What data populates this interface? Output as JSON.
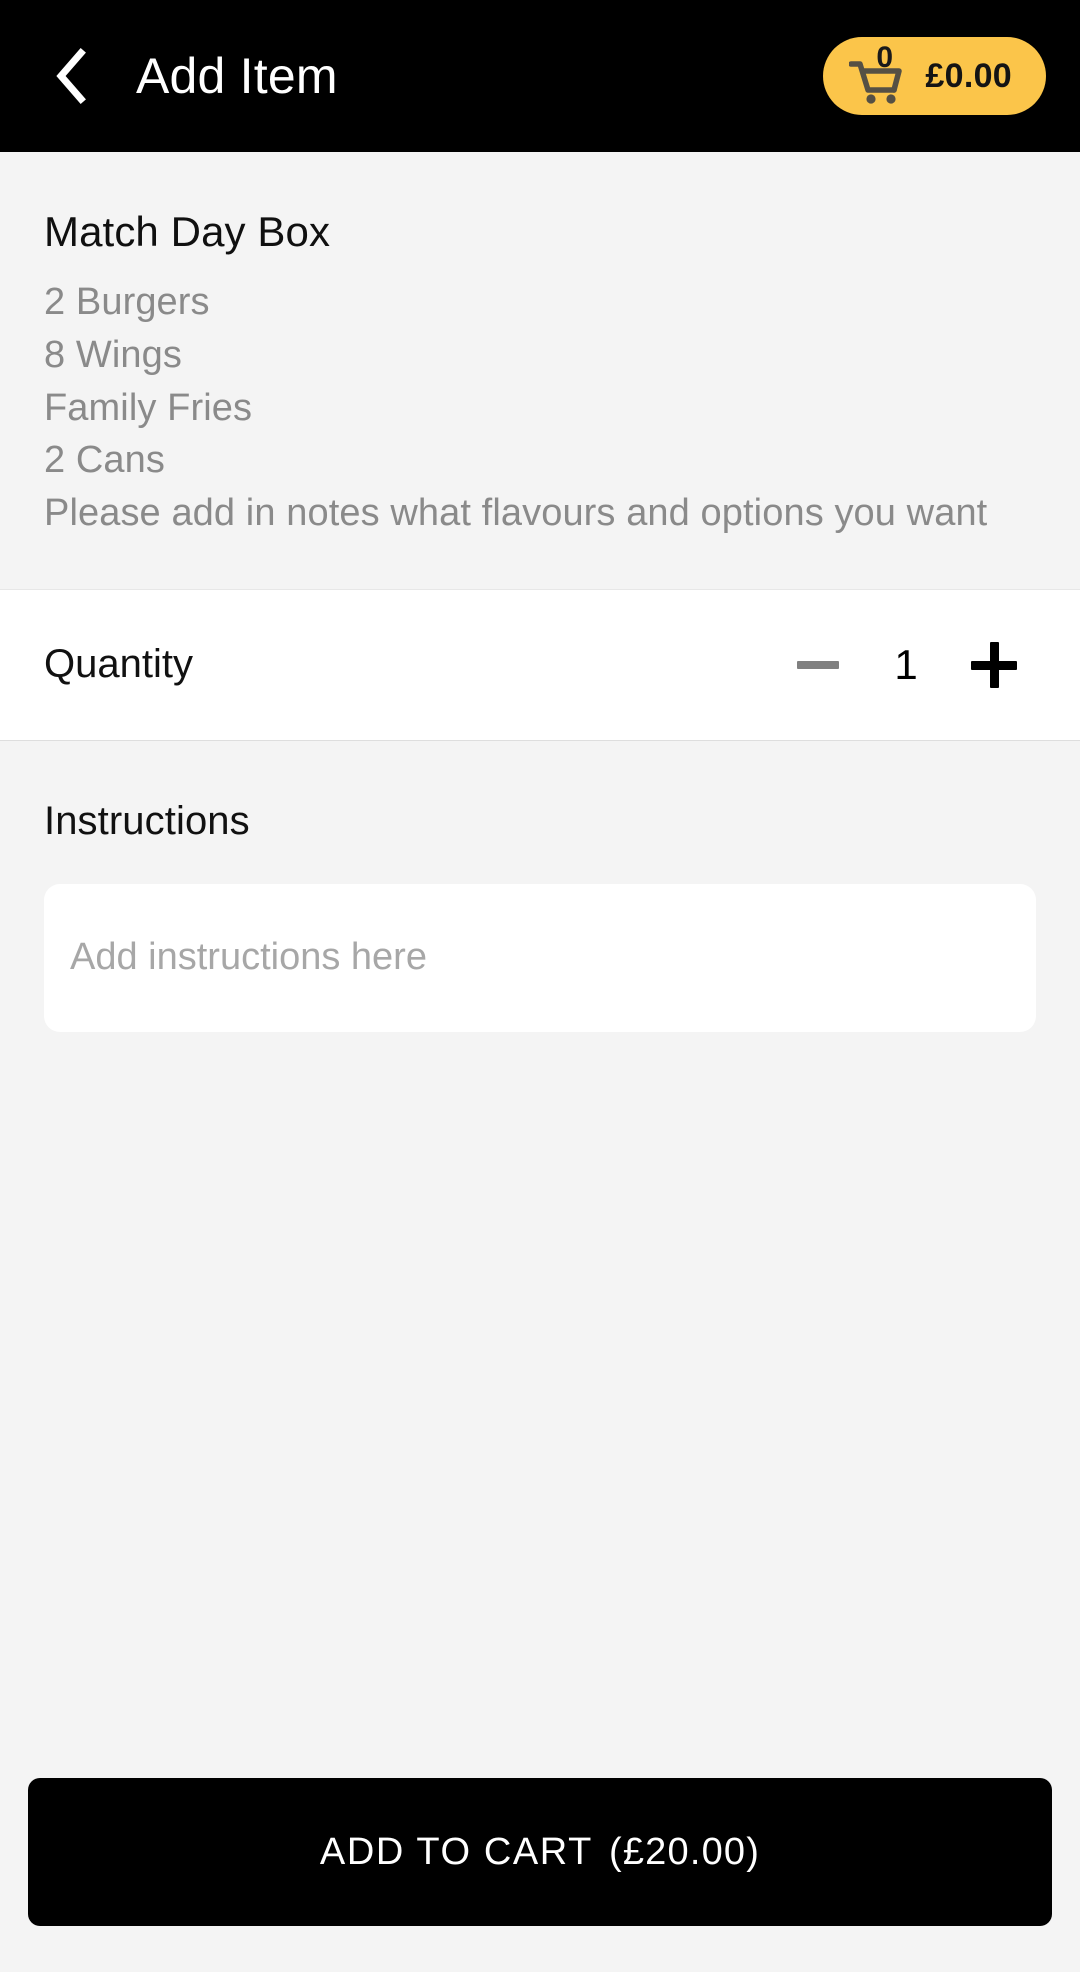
{
  "header": {
    "back_icon": "chevron-left-icon",
    "title": "Add Item",
    "cart": {
      "icon": "shopping-cart-icon",
      "badge_count": "0",
      "total": "£0.00",
      "pill_color": "#FBC54A"
    }
  },
  "item": {
    "name": "Match Day Box",
    "description_lines": [
      "2 Burgers",
      "8 Wings",
      "Family Fries",
      "2 Cans",
      "Please add in notes what flavours and options you want"
    ]
  },
  "quantity": {
    "label": "Quantity",
    "value": "1",
    "decrement_icon": "minus-icon",
    "increment_icon": "plus-icon",
    "decrement_color": "#808080",
    "increment_color": "#000000"
  },
  "instructions": {
    "heading": "Instructions",
    "value": "",
    "placeholder": "Add instructions here"
  },
  "footer": {
    "add_to_cart_label": "ADD TO CART",
    "add_to_cart_price": "(£20.00)"
  }
}
